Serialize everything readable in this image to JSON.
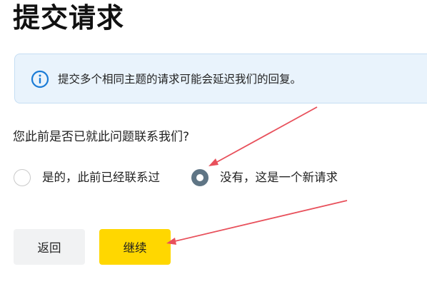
{
  "page": {
    "title": "提交请求"
  },
  "info_banner": {
    "icon": "info-icon",
    "text": "提交多个相同主题的请求可能会延迟我们的回复。",
    "background": "#e9f3fc",
    "icon_color": "#1a7bd6"
  },
  "question": {
    "text": "您此前是否已就此问题联系我们?"
  },
  "radio_options": [
    {
      "label": "是的，此前已经联系过",
      "checked": false
    },
    {
      "label": "没有，这是一个新请求",
      "checked": true
    }
  ],
  "buttons": {
    "back_label": "返回",
    "continue_label": "继续"
  },
  "colors": {
    "accent_yellow": "#ffd700",
    "radio_selected": "#5f7585",
    "annotation_arrow": "#e8505b"
  }
}
